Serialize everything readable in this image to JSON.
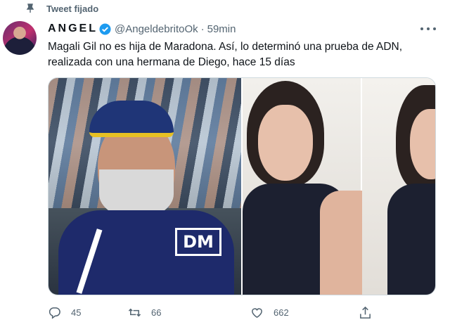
{
  "pinned": {
    "label": "Tweet fijado"
  },
  "tweet": {
    "display_name": "ANGEL",
    "handle": "@AngeldebritoOk",
    "separator": "·",
    "time": "59min",
    "text_line1": "Magali Gil no es hija de Maradona. Así, lo determinó una prueba de ADN,",
    "text_line2": "realizada con una hermana de Diego, hace 15 días"
  },
  "media": {
    "left_logo": "DM"
  },
  "actions": {
    "reply_count": "45",
    "retweet_count": "66",
    "like_count": "662"
  },
  "colors": {
    "verified": "#1d9bf0",
    "secondary_text": "#536471",
    "primary_text": "#0f1419"
  },
  "icons": [
    "pin-icon",
    "verified-icon",
    "more-icon",
    "reply-icon",
    "retweet-icon",
    "like-icon",
    "share-icon"
  ]
}
